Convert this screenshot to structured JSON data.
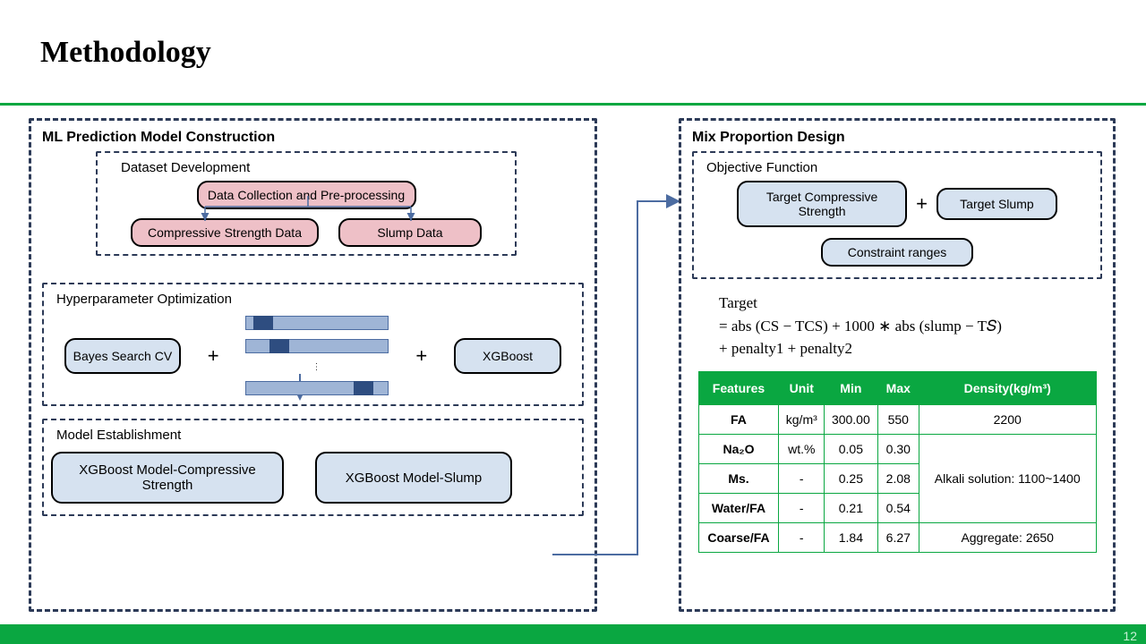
{
  "title": "Methodology",
  "page_number": "12",
  "left": {
    "panel_title": "ML Prediction Model Construction",
    "dataset": {
      "label": "Dataset Development",
      "collect": "Data Collection and Pre-processing",
      "cs": "Compressive Strength Data",
      "slump": "Slump Data"
    },
    "hyper": {
      "label": "Hyperparameter Optimization",
      "bayes": "Bayes Search CV",
      "xgb": "XGBoost"
    },
    "model": {
      "label": "Model Establishment",
      "cs": "XGBoost Model-Compressive Strength",
      "slump": "XGBoost Model-Slump"
    }
  },
  "right": {
    "panel_title": "Mix Proportion Design",
    "obj": {
      "label": "Objective Function",
      "tcs": "Target Compressive Strength",
      "ts": "Target Slump",
      "cr": "Constraint ranges"
    },
    "equation_l1": "Target",
    "equation_l2": "= abs (CS − TCS) + 1000 ∗ abs (slump − T𝑆)",
    "equation_l3": "+ penalty1 + penalty2"
  },
  "plus": "+",
  "table": {
    "headers": [
      "Features",
      "Unit",
      "Min",
      "Max",
      "Density(kg/m³)"
    ],
    "rows": [
      {
        "f": "FA",
        "u": "kg/m³",
        "min": "300.00",
        "max": "550",
        "d": "2200"
      },
      {
        "f": "Na₂O",
        "u": "wt.%",
        "min": "0.05",
        "max": "0.30"
      },
      {
        "f": "Ms.",
        "u": "-",
        "min": "0.25",
        "max": "2.08"
      },
      {
        "f": "Water/FA",
        "u": "-",
        "min": "0.21",
        "max": "0.54"
      },
      {
        "f": "Coarse/FA",
        "u": "-",
        "min": "1.84",
        "max": "6.27",
        "d": "Aggregate: 2650"
      }
    ],
    "alkali": "Alkali solution: 1100~1400"
  }
}
